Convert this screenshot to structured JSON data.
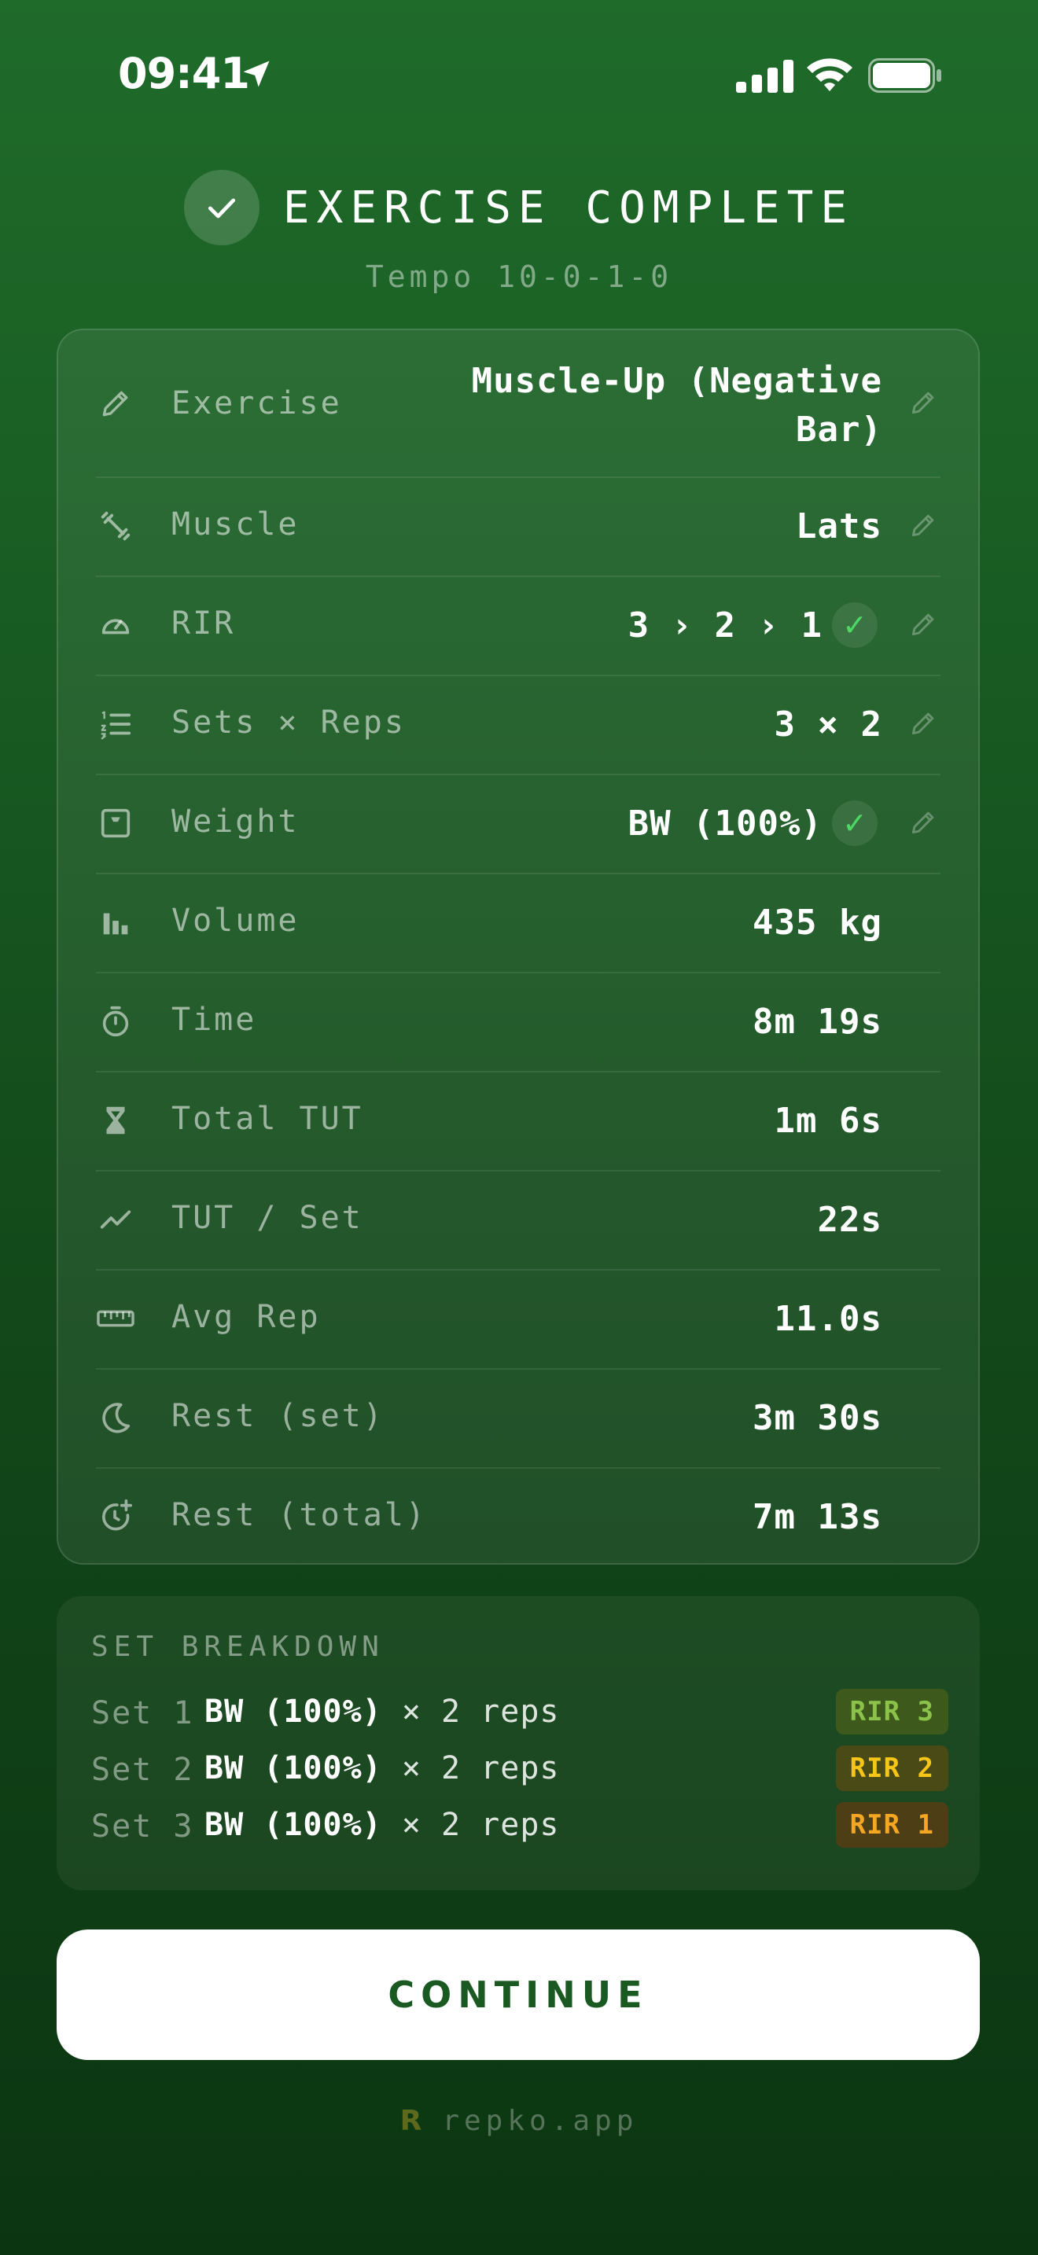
{
  "status_bar": {
    "time": "09:41"
  },
  "header": {
    "title": "EXERCISE COMPLETE",
    "subtitle": "Tempo 10-0-1-0"
  },
  "stats": {
    "exercise": {
      "label": "Exercise",
      "value": "Muscle-Up (Negative Bar)"
    },
    "muscle": {
      "label": "Muscle",
      "value": "Lats"
    },
    "rir": {
      "label": "RIR",
      "value": "3 › 2 › 1"
    },
    "sets_reps": {
      "label": "Sets × Reps",
      "value": "3 × 2"
    },
    "weight": {
      "label": "Weight",
      "value": "BW (100%)"
    },
    "volume": {
      "label": "Volume",
      "value": "435 kg"
    },
    "time": {
      "label": "Time",
      "value": "8m 19s"
    },
    "total_tut": {
      "label": "Total TUT",
      "value": "1m 6s"
    },
    "tut_per_set": {
      "label": "TUT / Set",
      "value": "22s"
    },
    "avg_rep": {
      "label": "Avg Rep",
      "value": "11.0s"
    },
    "rest_set": {
      "label": "Rest (set)",
      "value": "3m 30s"
    },
    "rest_total": {
      "label": "Rest (total)",
      "value": "7m 13s"
    },
    "check_glyph": "✓"
  },
  "breakdown": {
    "title": "SET BREAKDOWN",
    "sets": [
      {
        "label": "Set 1",
        "weight": "BW (100%)",
        "reps": "× 2 reps",
        "rir": "RIR 3",
        "rir_color": "#8bc34a",
        "rir_bg": "#3d5a1c"
      },
      {
        "label": "Set 2",
        "weight": "BW (100%)",
        "reps": "× 2 reps",
        "rir": "RIR 2",
        "rir_color": "#f5c518",
        "rir_bg": "#4a4a17"
      },
      {
        "label": "Set 3",
        "weight": "BW (100%)",
        "reps": "× 2 reps",
        "rir": "RIR 1",
        "rir_color": "#f5a623",
        "rir_bg": "#4d3e16"
      }
    ]
  },
  "continue": {
    "label": "CONTINUE"
  },
  "footer": {
    "logo": "R",
    "text": "repko.app"
  },
  "colors": {
    "accent": "#1a5a22",
    "success": "#4cd964"
  }
}
